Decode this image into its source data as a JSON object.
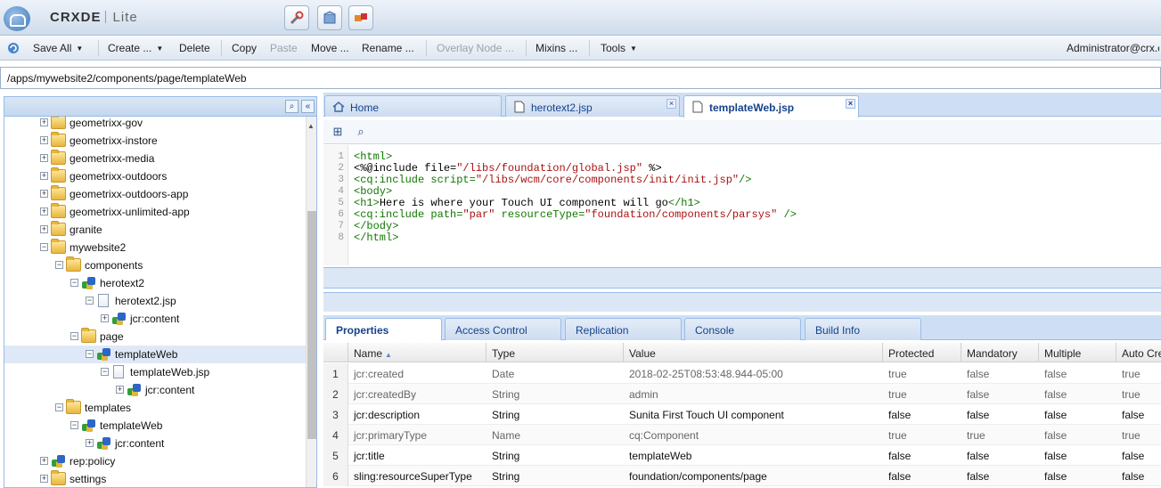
{
  "app": {
    "name_main": "CRX",
    "name_de": "DE",
    "name_lite": "Lite"
  },
  "toolbar": {
    "save_all": "Save All",
    "create": "Create ...",
    "delete": "Delete",
    "copy": "Copy",
    "paste": "Paste",
    "move": "Move ...",
    "rename": "Rename ...",
    "overlay": "Overlay Node ...",
    "mixins": "Mixins ...",
    "tools": "Tools",
    "user": "Administrator@crx.c"
  },
  "path": "/apps/mywebsite2/components/page/templateWeb",
  "tree": [
    {
      "label": "geometrixx-gov",
      "type": "folder",
      "depth": 0
    },
    {
      "label": "geometrixx-instore",
      "type": "folder",
      "depth": 0
    },
    {
      "label": "geometrixx-media",
      "type": "folder",
      "depth": 0
    },
    {
      "label": "geometrixx-outdoors",
      "type": "folder",
      "depth": 0
    },
    {
      "label": "geometrixx-outdoors-app",
      "type": "folder",
      "depth": 0
    },
    {
      "label": "geometrixx-unlimited-app",
      "type": "folder",
      "depth": 0
    },
    {
      "label": "granite",
      "type": "folder",
      "depth": 0
    },
    {
      "label": "mywebsite2",
      "type": "folder",
      "depth": 0,
      "expanded": true
    },
    {
      "label": "components",
      "type": "folder",
      "depth": 1,
      "expanded": true
    },
    {
      "label": "herotext2",
      "type": "comp",
      "depth": 2,
      "expanded": true
    },
    {
      "label": "herotext2.jsp",
      "type": "file",
      "depth": 3,
      "expanded": true
    },
    {
      "label": "jcr:content",
      "type": "comp",
      "depth": 4
    },
    {
      "label": "page",
      "type": "folder",
      "depth": 2,
      "expanded": true
    },
    {
      "label": "templateWeb",
      "type": "comp",
      "depth": 3,
      "expanded": true,
      "selected": true
    },
    {
      "label": "templateWeb.jsp",
      "type": "file",
      "depth": 4,
      "expanded": true
    },
    {
      "label": "jcr:content",
      "type": "comp",
      "depth": 5
    },
    {
      "label": "templates",
      "type": "folder",
      "depth": 1,
      "expanded": true
    },
    {
      "label": "templateWeb",
      "type": "comp",
      "depth": 2,
      "expanded": true
    },
    {
      "label": "jcr:content",
      "type": "comp",
      "depth": 3
    },
    {
      "label": "rep:policy",
      "type": "comp",
      "depth": 0
    },
    {
      "label": "settings",
      "type": "folder",
      "depth": 0
    }
  ],
  "tabs": {
    "home": "Home",
    "herotext": "herotext2.jsp",
    "template": "templateWeb.jsp"
  },
  "code": [
    {
      "n": "1",
      "parts": [
        [
          "tag",
          "<html>"
        ]
      ]
    },
    {
      "n": "2",
      "parts": [
        [
          "txt",
          "<%@include file="
        ],
        [
          "str",
          "\"/libs/foundation/global.jsp\""
        ],
        [
          "txt",
          " %>"
        ]
      ]
    },
    {
      "n": "3",
      "parts": [
        [
          "tag",
          "<cq:include "
        ],
        [
          "tag",
          "script="
        ],
        [
          "str",
          "\"/libs/wcm/core/components/init/init.jsp\""
        ],
        [
          "tag",
          "/>"
        ]
      ]
    },
    {
      "n": "4",
      "parts": [
        [
          "tag",
          "<body>"
        ]
      ]
    },
    {
      "n": "5",
      "parts": [
        [
          "tag",
          "<h1>"
        ],
        [
          "txt",
          "Here is where your Touch UI component will go"
        ],
        [
          "tag",
          "</h1>"
        ]
      ]
    },
    {
      "n": "6",
      "parts": [
        [
          "tag",
          "<cq:include "
        ],
        [
          "tag",
          "path="
        ],
        [
          "str",
          "\"par\""
        ],
        [
          "tag",
          " resourceType="
        ],
        [
          "str",
          "\"foundation/components/parsys\""
        ],
        [
          "tag",
          " />"
        ]
      ]
    },
    {
      "n": "7",
      "parts": [
        [
          "tag",
          "</body>"
        ]
      ]
    },
    {
      "n": "8",
      "parts": [
        [
          "tag",
          "</html>"
        ]
      ]
    }
  ],
  "bottom_tabs": [
    "Properties",
    "Access Control",
    "Replication",
    "Console",
    "Build Info"
  ],
  "grid": {
    "headers": [
      "Name",
      "Type",
      "Value",
      "Protected",
      "Mandatory",
      "Multiple",
      "Auto Cre"
    ],
    "rows": [
      {
        "n": "1",
        "name": "jcr:created",
        "type": "Date",
        "value": "2018-02-25T08:53:48.944-05:00",
        "protected": "true",
        "mandatory": "false",
        "multiple": "false",
        "auto": "true",
        "editable": false
      },
      {
        "n": "2",
        "name": "jcr:createdBy",
        "type": "String",
        "value": "admin",
        "protected": "true",
        "mandatory": "false",
        "multiple": "false",
        "auto": "true",
        "editable": false
      },
      {
        "n": "3",
        "name": "jcr:description",
        "type": "String",
        "value": "Sunita First Touch UI component",
        "protected": "false",
        "mandatory": "false",
        "multiple": "false",
        "auto": "false",
        "editable": true
      },
      {
        "n": "4",
        "name": "jcr:primaryType",
        "type": "Name",
        "value": "cq:Component",
        "protected": "true",
        "mandatory": "true",
        "multiple": "false",
        "auto": "true",
        "editable": false
      },
      {
        "n": "5",
        "name": "jcr:title",
        "type": "String",
        "value": "templateWeb",
        "protected": "false",
        "mandatory": "false",
        "multiple": "false",
        "auto": "false",
        "editable": true
      },
      {
        "n": "6",
        "name": "sling:resourceSuperType",
        "type": "String",
        "value": "foundation/components/page",
        "protected": "false",
        "mandatory": "false",
        "multiple": "false",
        "auto": "false",
        "editable": true
      }
    ]
  }
}
